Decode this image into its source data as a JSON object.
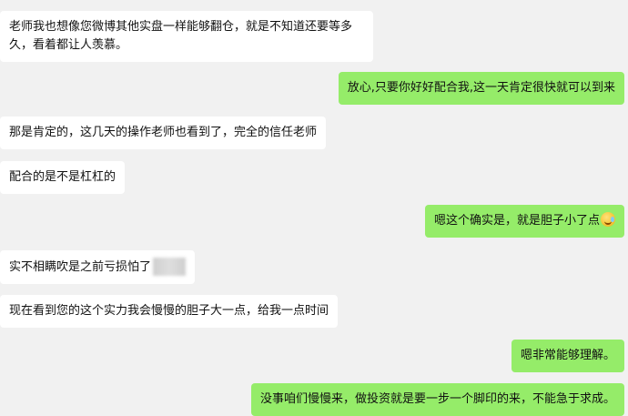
{
  "messages": [
    {
      "side": "incoming",
      "text": "老师我也想像您微博其他实盘一样能够翻仓，就是不知道还要等多久，看着都让人羡慕。"
    },
    {
      "side": "outgoing",
      "text": "放心,只要你好好配合我,这一天肯定很快就可以到来"
    },
    {
      "side": "incoming",
      "text": "那是肯定的，这几天的操作老师也看到了，完全的信任老师"
    },
    {
      "side": "incoming",
      "text": "配合的是不是杠杠的"
    },
    {
      "side": "outgoing",
      "text": "嗯这个确实是，就是胆子小了点",
      "emoji": "laugh-cry-emoji"
    },
    {
      "side": "incoming",
      "text": "实不相瞒吹是之前亏损怕了",
      "redacted": true
    },
    {
      "side": "incoming",
      "text": "现在看到您的这个实力我会慢慢的胆子大一点，给我一点时间"
    },
    {
      "side": "outgoing",
      "text": "嗯非常能够理解。"
    },
    {
      "side": "outgoing",
      "text": "没事咱们慢慢来，做投资就是要一步一个脚印的来，不能急于求成。"
    }
  ]
}
